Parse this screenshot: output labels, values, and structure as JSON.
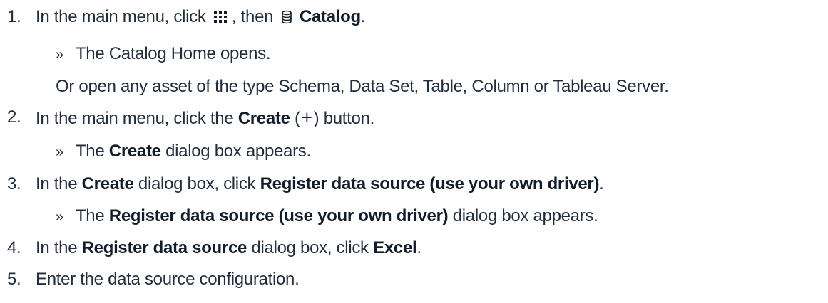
{
  "steps": [
    {
      "number": "1.",
      "pre": "In the main menu, click",
      "icon1": "apps-grid-icon",
      "mid": ", then",
      "icon2": "database-icon",
      "target": "Catalog",
      "post": ".",
      "result": "The Catalog Home opens.",
      "alt": "Or open any asset of the type Schema, Data Set, Table, Column or Tableau Server."
    },
    {
      "number": "2.",
      "pre": "In the main menu, click the",
      "target": "Create",
      "paren_open": "(",
      "plus": "+",
      "paren_close": ")",
      "post": " button.",
      "result_pre": "The",
      "result_bold": "Create",
      "result_post": "dialog box appears."
    },
    {
      "number": "3.",
      "pre": "In the",
      "bold1": "Create",
      "mid": "dialog box, click",
      "bold2": "Register data source (use your own driver)",
      "post": ".",
      "result_pre": "The",
      "result_bold": "Register data source (use your own driver)",
      "result_post": "dialog box appears."
    },
    {
      "number": "4.",
      "pre": "In the",
      "bold1": "Register data source",
      "mid": "dialog box, click",
      "bold2": "Excel",
      "post": "."
    },
    {
      "number": "5.",
      "text": "Enter the data source configuration."
    }
  ],
  "result_marker": "»"
}
